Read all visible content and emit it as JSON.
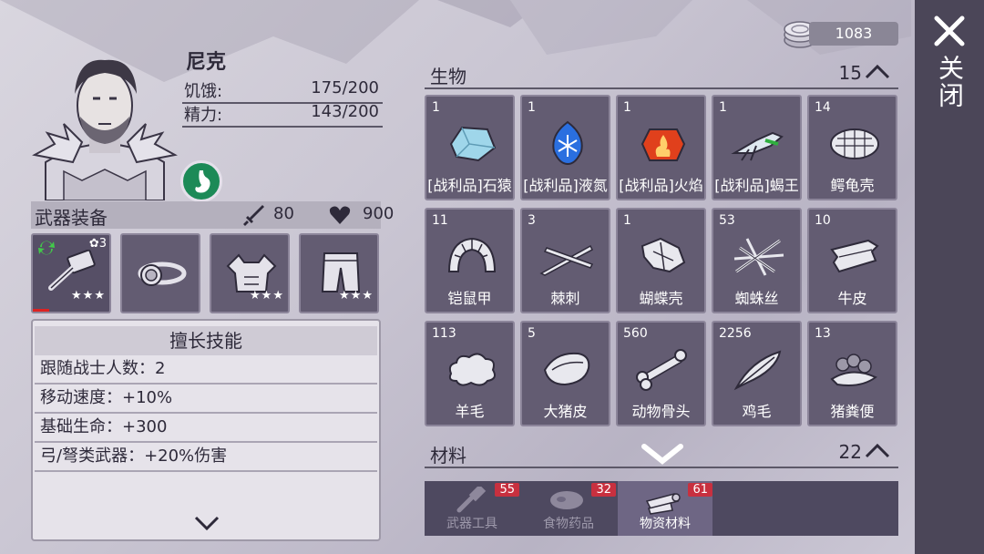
{
  "coins": "1083",
  "close_label": "关闭",
  "character": {
    "name": "尼克",
    "stats": [
      {
        "label": "饥饿:",
        "value": "175/200"
      },
      {
        "label": "精力:",
        "value": "143/200"
      }
    ]
  },
  "equipment": {
    "title": "武器装备",
    "attack": "80",
    "health": "900",
    "slots": [
      {
        "icon": "hammer-icon",
        "stars": "★★★",
        "badge": "✿3"
      },
      {
        "icon": "headlamp-icon",
        "stars": ""
      },
      {
        "icon": "armor-icon",
        "stars": "★★★"
      },
      {
        "icon": "pants-icon",
        "stars": "★★★"
      }
    ]
  },
  "skills": {
    "title": "擅长技能",
    "items": [
      "跟随战士人数：2",
      "移动速度：+10%",
      "基础生命：+300",
      "弓/弩类武器：+20%伤害"
    ]
  },
  "sections": {
    "creatures": {
      "title": "生物",
      "count": "15"
    },
    "materials": {
      "title": "材料",
      "count": "22"
    }
  },
  "items": [
    {
      "count": "1",
      "name": "[战利品]石猿",
      "icon": "crystal-icon",
      "color": "#9fd6ea"
    },
    {
      "count": "1",
      "name": "[战利品]液氮",
      "icon": "snowflake-gem-icon",
      "color": "#2a6fe0"
    },
    {
      "count": "1",
      "name": "[战利品]火焰",
      "icon": "fire-gem-icon",
      "color": "#e0401c"
    },
    {
      "count": "1",
      "name": "[战利品]蝎王",
      "icon": "scorpion-icon",
      "color": "#dfe8f0"
    },
    {
      "count": "14",
      "name": "鳄龟壳",
      "icon": "turtle-shell-icon",
      "color": "#e8e8ee"
    },
    {
      "count": "11",
      "name": "铠鼠甲",
      "icon": "armadillo-shell-icon",
      "color": "#e8e8ee"
    },
    {
      "count": "3",
      "name": "棘刺",
      "icon": "spike-icon",
      "color": "#e8e8ee"
    },
    {
      "count": "1",
      "name": "蝴蝶壳",
      "icon": "butterfly-shell-icon",
      "color": "#e8e8ee"
    },
    {
      "count": "53",
      "name": "蜘蛛丝",
      "icon": "spider-silk-icon",
      "color": "#e8e8ee"
    },
    {
      "count": "10",
      "name": "牛皮",
      "icon": "cowhide-icon",
      "color": "#e8e8ee"
    },
    {
      "count": "113",
      "name": "羊毛",
      "icon": "wool-icon",
      "color": "#e8e8ee"
    },
    {
      "count": "5",
      "name": "大猪皮",
      "icon": "pig-hide-icon",
      "color": "#e8e8ee"
    },
    {
      "count": "560",
      "name": "动物骨头",
      "icon": "bone-icon",
      "color": "#e8e8ee"
    },
    {
      "count": "2256",
      "name": "鸡毛",
      "icon": "feather-icon",
      "color": "#e8e8ee"
    },
    {
      "count": "13",
      "name": "猪粪便",
      "icon": "manure-icon",
      "color": "#e8e8ee"
    }
  ],
  "tabs": [
    {
      "label": "武器工具",
      "badge": "55",
      "icon": "tools-icon"
    },
    {
      "label": "食物药品",
      "badge": "32",
      "icon": "meat-icon"
    },
    {
      "label": "物资材料",
      "badge": "61",
      "icon": "logs-icon",
      "active": true
    }
  ]
}
